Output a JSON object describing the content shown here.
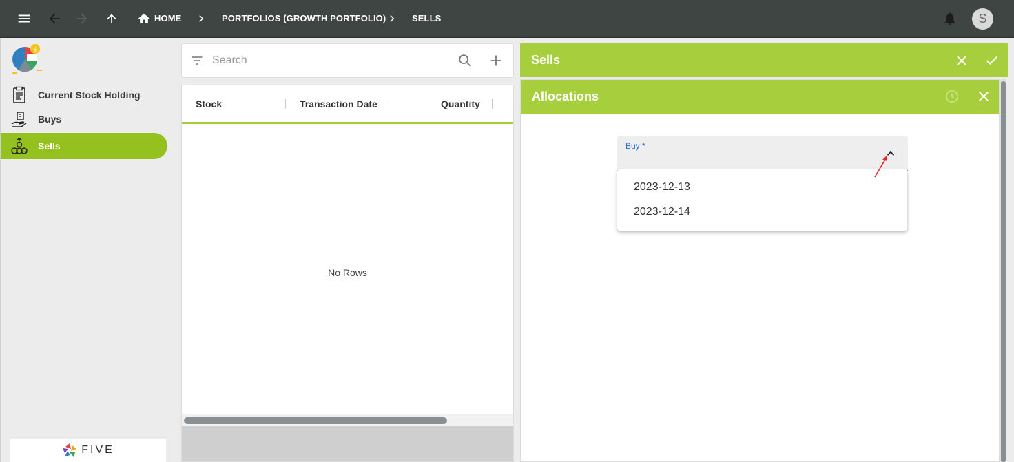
{
  "topbar": {
    "breadcrumbs": [
      {
        "label": "HOME"
      },
      {
        "label": "PORTFOLIOS (GROWTH PORTFOLIO)"
      },
      {
        "label": "SELLS"
      }
    ],
    "avatar_initial": "S"
  },
  "sidebar": {
    "items": [
      {
        "label": "Current Stock Holding",
        "icon": "clipboard-chart-icon"
      },
      {
        "label": "Buys",
        "icon": "hand-money-icon"
      },
      {
        "label": "Sells",
        "icon": "coins-icon",
        "active": true
      }
    ],
    "footer_logo_text": "FIVE"
  },
  "search": {
    "placeholder": "Search"
  },
  "grid": {
    "columns": [
      "Stock",
      "Transaction Date",
      "Quantity"
    ],
    "empty_text": "No Rows"
  },
  "sells_panel": {
    "title": "Sells"
  },
  "allocations_panel": {
    "title": "Allocations"
  },
  "buy_field": {
    "label": "Buy *",
    "options": [
      "2023-12-13",
      "2023-12-14"
    ]
  },
  "colors": {
    "topbar": "#3f4543",
    "accent_green": "#a7ce3c",
    "active_nav": "#95c11f",
    "label_blue": "#2b6dd6",
    "annotation_red": "#e0262b"
  }
}
